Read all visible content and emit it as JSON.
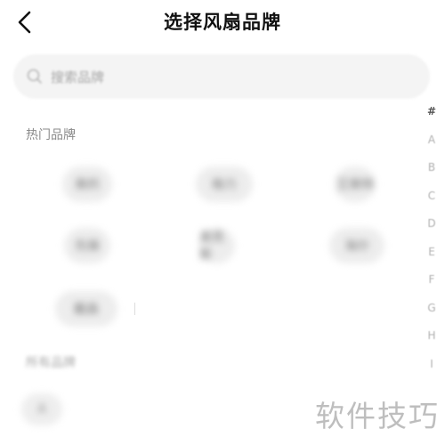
{
  "header": {
    "title": "选择风扇品牌",
    "back_icon": "chevron-left-icon"
  },
  "search": {
    "placeholder": "搜索品牌"
  },
  "sections": {
    "hot_label": "热门品牌",
    "all_label": "所有品牌"
  },
  "hot_brands": [
    {
      "label": "美的"
    },
    {
      "label": "格力"
    },
    {
      "label": "艾美特"
    },
    {
      "label": "先锋"
    },
    {
      "label": "奥克斯"
    },
    {
      "label": "海尔"
    },
    {
      "label": "戴森"
    }
  ],
  "all_brands": [
    {
      "label": "A"
    }
  ],
  "index_letters": [
    "#",
    "A",
    "B",
    "C",
    "D",
    "E",
    "F",
    "G",
    "H",
    "I"
  ],
  "watermark": "软件技巧",
  "colors": {
    "search_bg": "#f4f4f4",
    "chip_bg": "#ededed",
    "label_text": "#8a8a8a",
    "index_text": "#b0b0b0"
  }
}
